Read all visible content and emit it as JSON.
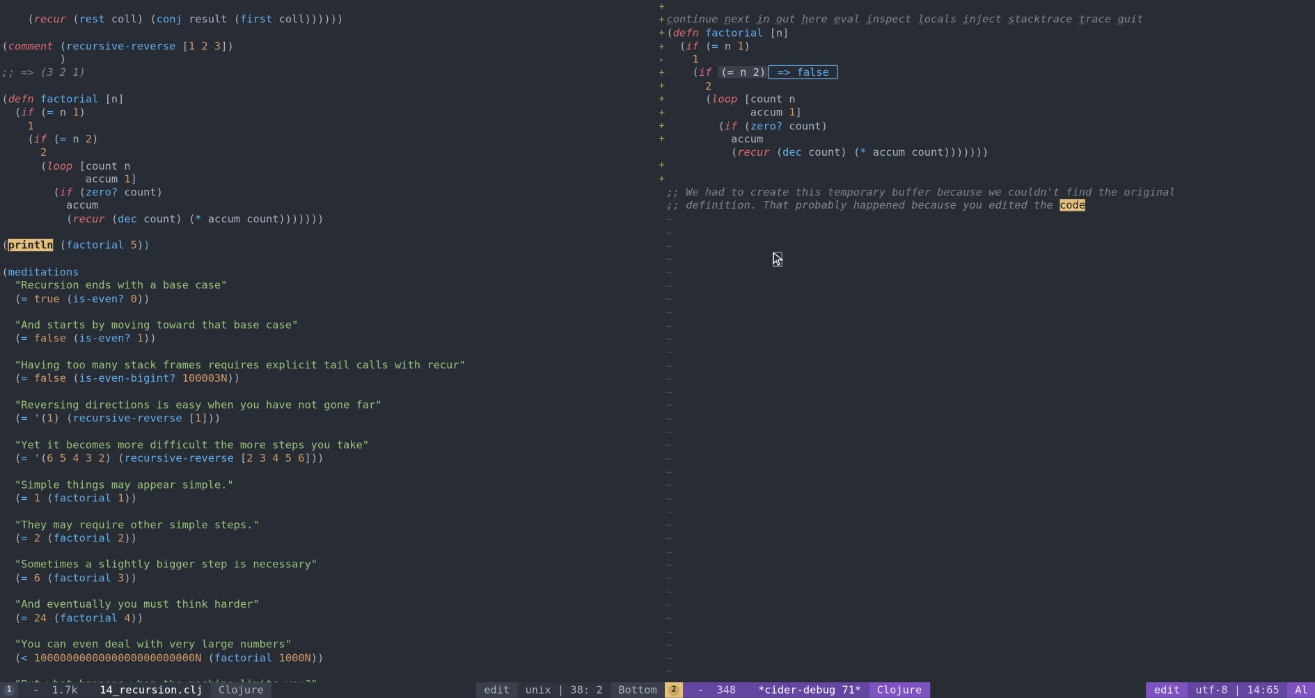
{
  "left_buffer": {
    "lines": [
      "    (recur (rest coll) (conj result (first coll))))))",
      "",
      "(comment (recursive-reverse [1 2 3])",
      "         )",
      ";; => (3 2 1)",
      "",
      "(defn factorial [n]",
      "  (if (= n 1)",
      "    1",
      "    (if (= n 2)",
      "      2",
      "      (loop [count n",
      "             accum 1]",
      "        (if (zero? count)",
      "          accum",
      "          (recur (dec count) (* accum count)))))))",
      "",
      "(println (factorial 5))",
      "",
      "(meditations",
      "  \"Recursion ends with a base case\"",
      "  (= true (is-even? 0))",
      "",
      "  \"And starts by moving toward that base case\"",
      "  (= false (is-even? 1))",
      "",
      "  \"Having too many stack frames requires explicit tail calls with recur\"",
      "  (= false (is-even-bigint? 100003N))",
      "",
      "  \"Reversing directions is easy when you have not gone far\"",
      "  (= '(1) (recursive-reverse [1]))",
      "",
      "  \"Yet it becomes more difficult the more steps you take\"",
      "  (= '(6 5 4 3 2) (recursive-reverse [2 3 4 5 6]))",
      "",
      "  \"Simple things may appear simple.\"",
      "  (= 1 (factorial 1))",
      "",
      "  \"They may require other simple steps.\"",
      "  (= 2 (factorial 2))",
      "",
      "  \"Sometimes a slightly bigger step is necessary\"",
      "  (= 6 (factorial 3))",
      "",
      "  \"And eventually you must think harder\"",
      "  (= 24 (factorial 4))",
      "",
      "  \"You can even deal with very large numbers\"",
      "  (< 1000000000000000000000000N (factorial 1000N))",
      "",
      "  \"But what happens when the machine limits you?\""
    ]
  },
  "right_buffer": {
    "debug_cmds": "continue next in out here eval inspect locals inject stacktrace trace quit",
    "eval_expr": "(= n 2)",
    "eval_result": " => false ",
    "comment1": ";; We had to create this temporary buffer because we couldn't find the original",
    "comment2": ";; definition. That probably happened because you edited the ",
    "comment2_hl": "code"
  },
  "status_left": {
    "indicator": "1",
    "size": " -  1.7k ",
    "filename": "14_recursion.clj",
    "mode": "Clojure",
    "state": "edit",
    "enc": "unix",
    "cursor": "38: 2",
    "pos": "Bottom"
  },
  "status_right": {
    "indicator": "2",
    "size": " -  348 ",
    "filename": "*cider-debug 71*",
    "mode": "Clojure",
    "state": "edit",
    "enc": "utf-8",
    "time": "14:65",
    "pos": "Al"
  }
}
